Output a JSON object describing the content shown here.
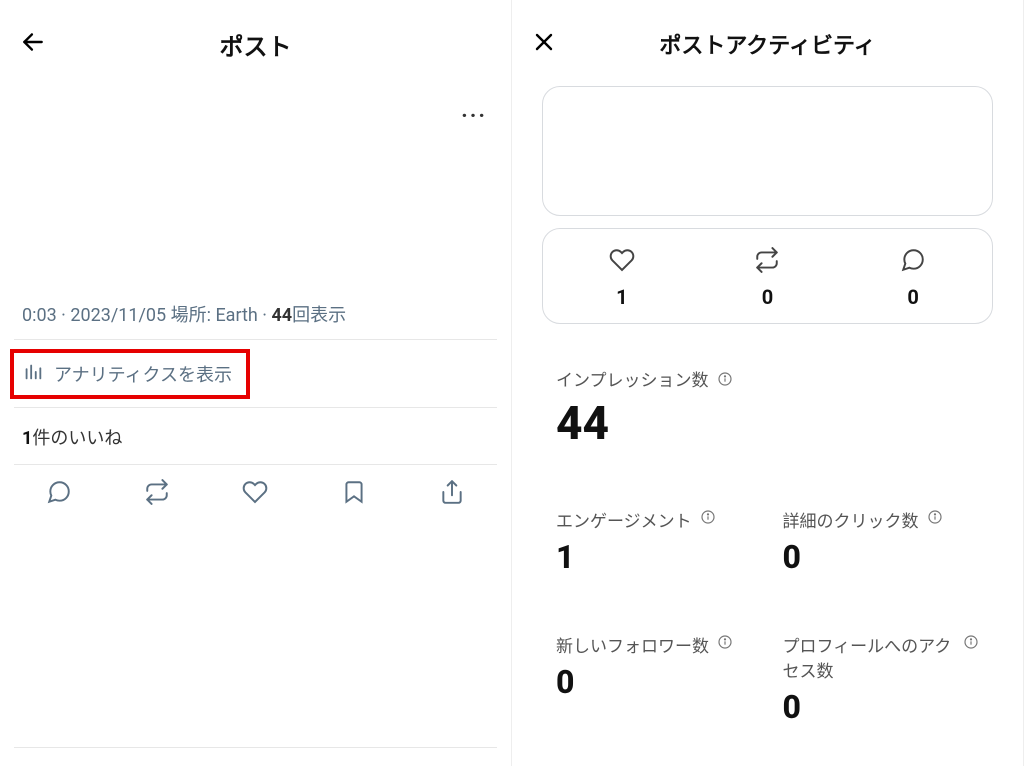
{
  "left": {
    "title": "ポスト",
    "meta": {
      "time": "0:03",
      "sep1": " · ",
      "date": "2023/11/05",
      "place_prefix": " 場所: ",
      "place": "Earth",
      "sep2": " · ",
      "views_num": "44",
      "views_label": "回表示"
    },
    "analytics_label": "アナリティクスを表示",
    "likes": {
      "count": "1",
      "label": "件のいいね"
    }
  },
  "right": {
    "title": "ポストアクティビティ",
    "stats": {
      "likes": "1",
      "retweets": "0",
      "replies": "0"
    },
    "impressions": {
      "label": "インプレッション数",
      "value": "44"
    },
    "engagement": {
      "label": "エンゲージメント",
      "value": "1"
    },
    "detail_clicks": {
      "label": "詳細のクリック数",
      "value": "0"
    },
    "new_followers": {
      "label": "新しいフォロワー数",
      "value": "0"
    },
    "profile_visits": {
      "label": "プロフィールへのアクセス数",
      "value": "0"
    }
  }
}
